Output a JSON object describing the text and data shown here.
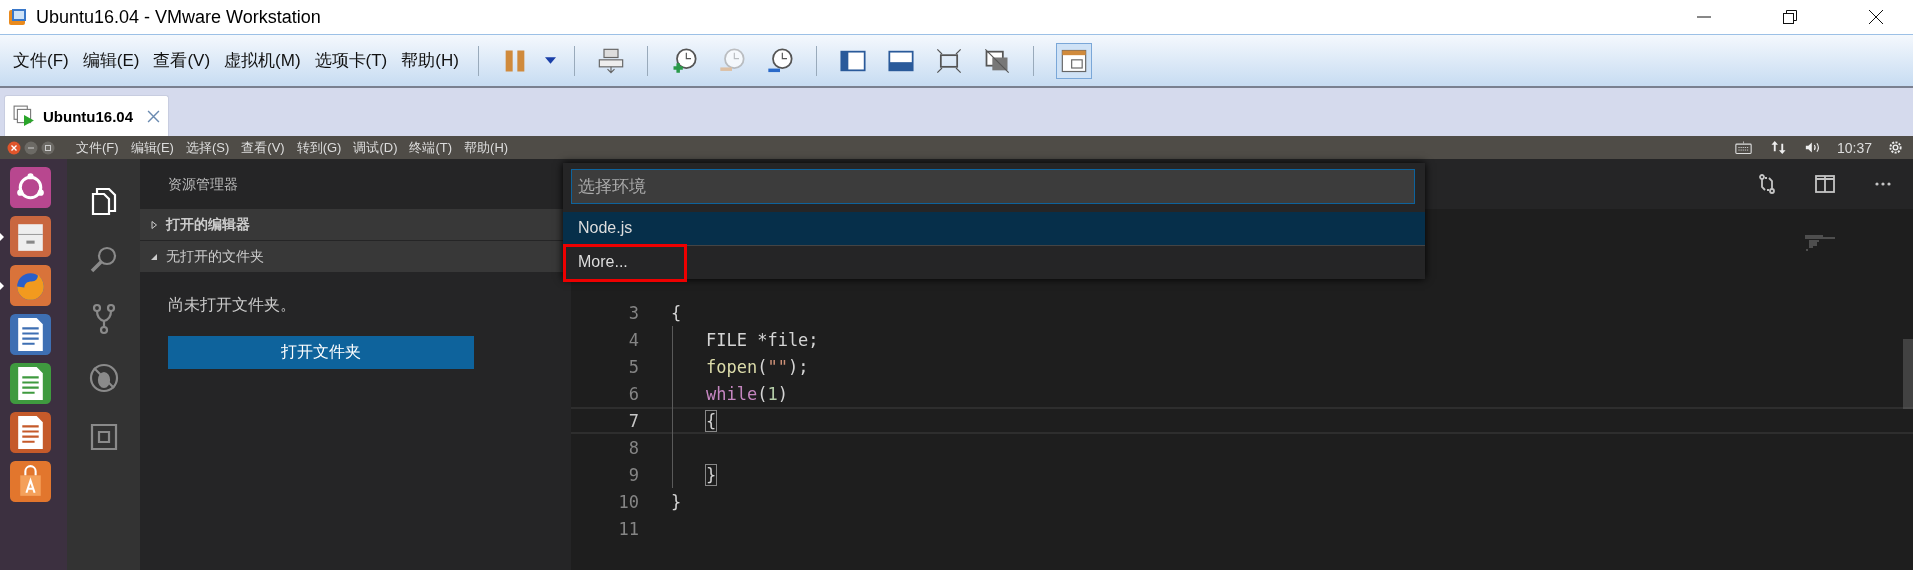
{
  "window": {
    "title": "Ubuntu16.04 - VMware Workstation"
  },
  "menu": [
    "文件(F)",
    "编辑(E)",
    "查看(V)",
    "虚拟机(M)",
    "选项卡(T)",
    "帮助(H)"
  ],
  "tabs": [
    {
      "label": "Ubuntu16.04",
      "selected": true
    }
  ],
  "guest_top_bar": {
    "menu": [
      "文件(F)",
      "编辑(E)",
      "选择(S)",
      "查看(V)",
      "转到(G)",
      "调试(D)",
      "终端(T)",
      "帮助(H)"
    ],
    "clock": "10:37"
  },
  "launcher": [
    {
      "kind": "ubuntu",
      "running": false
    },
    {
      "kind": "files",
      "running": true
    },
    {
      "kind": "firefox",
      "running": true
    },
    {
      "kind": "writer",
      "running": false
    },
    {
      "kind": "calc",
      "running": false
    },
    {
      "kind": "impress",
      "running": false
    },
    {
      "kind": "store",
      "running": false
    }
  ],
  "activity_bar": [
    {
      "kind": "explorer",
      "selected": true
    },
    {
      "kind": "search",
      "selected": false
    },
    {
      "kind": "git",
      "selected": false
    },
    {
      "kind": "debug",
      "selected": false
    },
    {
      "kind": "extensions",
      "selected": false
    }
  ],
  "sidebar": {
    "title": "资源管理器",
    "sections": [
      {
        "label": "打开的编辑器",
        "expanded": false
      },
      {
        "label": "无打开的文件夹",
        "expanded": true
      }
    ],
    "message": "尚未打开文件夹。",
    "button": "打开文件夹"
  },
  "quick_pick": {
    "placeholder": "选择环境",
    "items": [
      {
        "label": "Node.js",
        "selected": true,
        "highlighted": false
      },
      {
        "label": "More...",
        "selected": false,
        "highlighted": true
      }
    ]
  },
  "editor": {
    "lines": [
      {
        "number": "3",
        "current": false,
        "indent": false,
        "tokens": [
          {
            "text": "{",
            "kind": "plain"
          }
        ]
      },
      {
        "number": "4",
        "current": false,
        "indent": true,
        "tokens": [
          {
            "text": "FILE *file;",
            "kind": "plain"
          }
        ]
      },
      {
        "number": "5",
        "current": false,
        "indent": true,
        "tokens": [
          {
            "text": "fopen",
            "kind": "function"
          },
          {
            "text": "(",
            "kind": "plain"
          },
          {
            "text": "\"\"",
            "kind": "string"
          },
          {
            "text": ");",
            "kind": "plain"
          }
        ]
      },
      {
        "number": "6",
        "current": false,
        "indent": true,
        "tokens": [
          {
            "text": "while",
            "kind": "keyword"
          },
          {
            "text": "(",
            "kind": "plain"
          },
          {
            "text": "1",
            "kind": "number"
          },
          {
            "text": ")",
            "kind": "plain"
          }
        ]
      },
      {
        "number": "7",
        "current": true,
        "indent": true,
        "tokens": [
          {
            "text": "{",
            "kind": "bracket-match"
          }
        ]
      },
      {
        "number": "8",
        "current": false,
        "indent": true
      },
      {
        "number": "9",
        "current": false,
        "indent": true,
        "tokens": [
          {
            "text": "}",
            "kind": "bracket-match"
          }
        ]
      },
      {
        "number": "10",
        "current": false,
        "indent": false,
        "tokens": [
          {
            "text": "}",
            "kind": "plain"
          }
        ]
      },
      {
        "number": "11",
        "current": false,
        "indent": false
      }
    ]
  }
}
